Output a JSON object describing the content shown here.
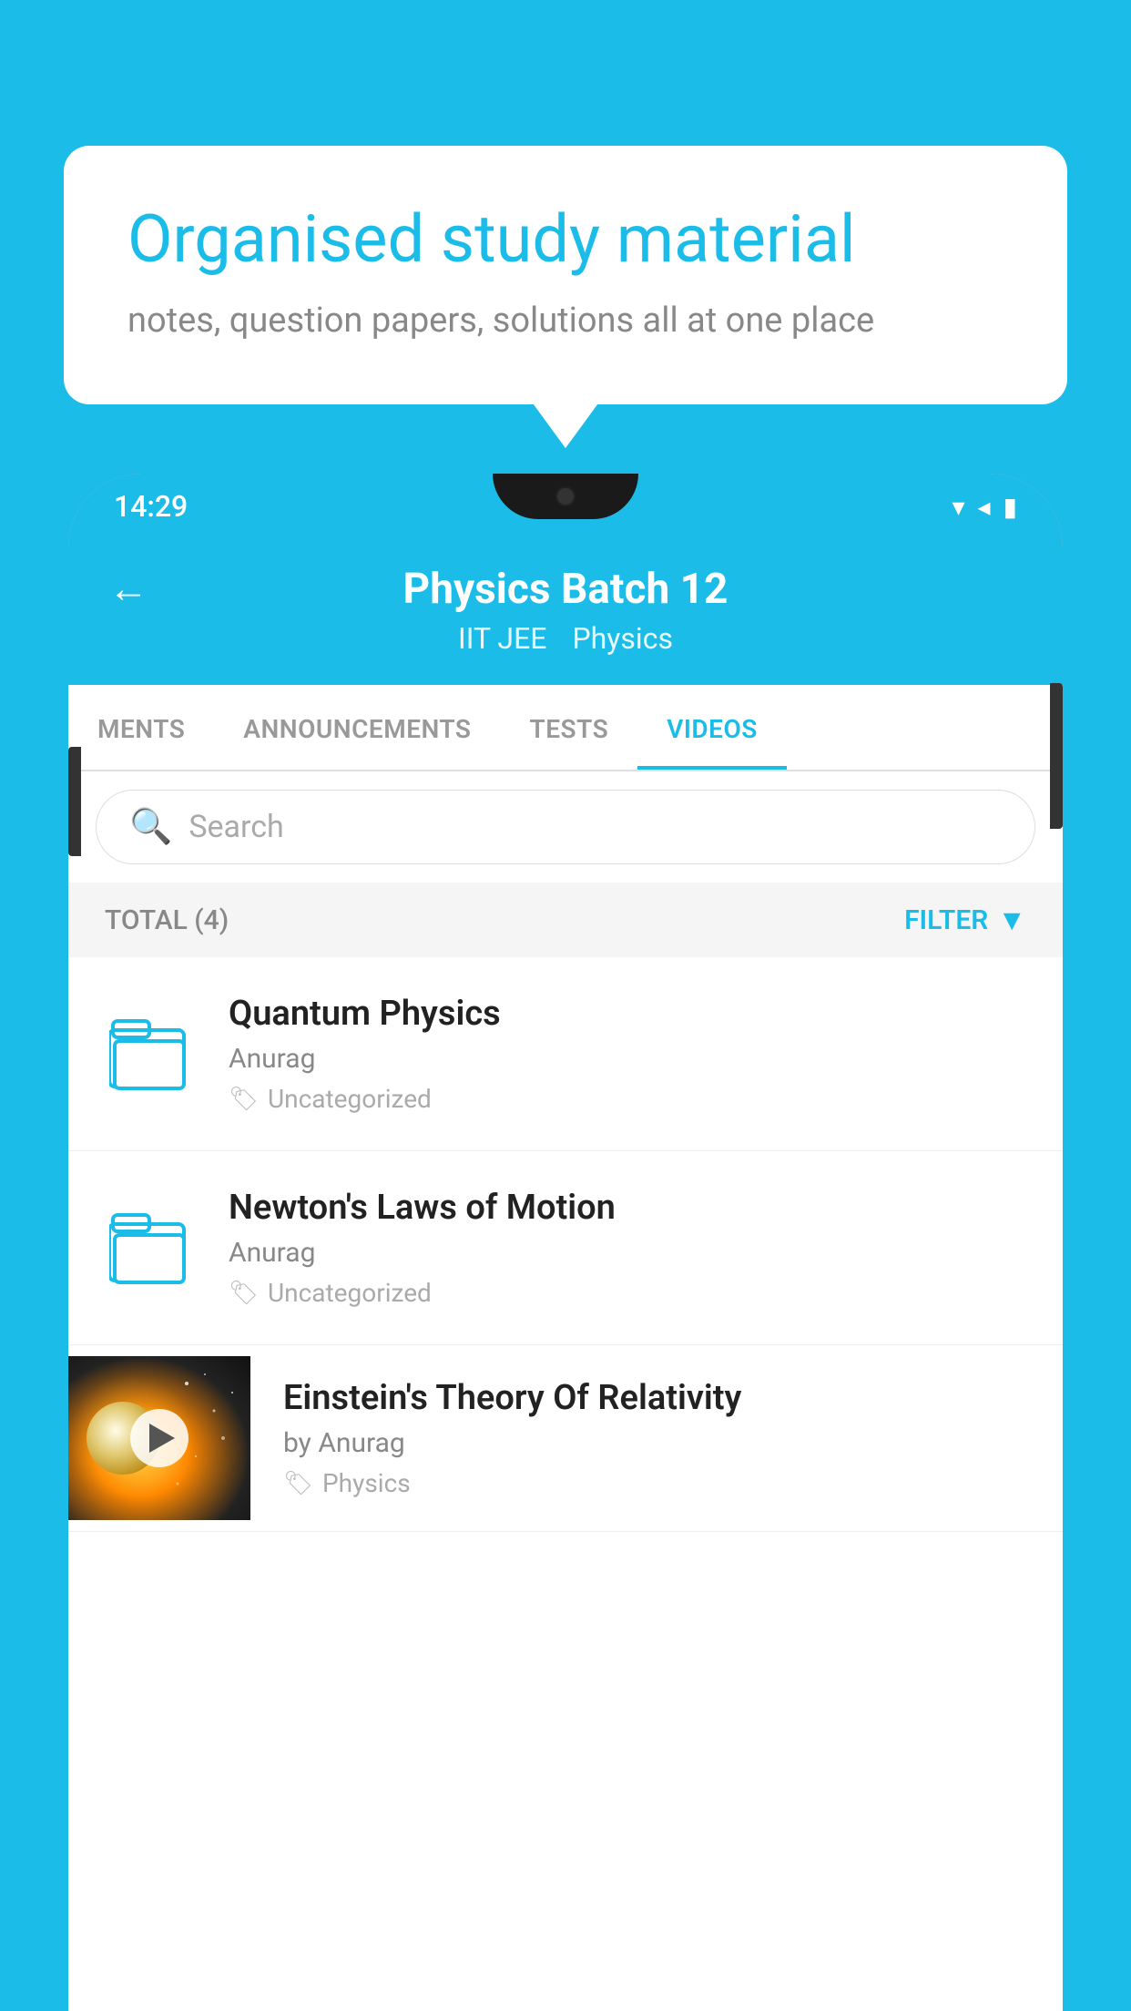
{
  "background": {
    "color": "#1bbde8"
  },
  "speech_bubble": {
    "title": "Organised study material",
    "subtitle": "notes, question papers, solutions all at one place"
  },
  "status_bar": {
    "time": "14:29",
    "wifi": "▾",
    "signal": "▴",
    "battery": "▮"
  },
  "app_header": {
    "title": "Physics Batch 12",
    "tag1": "IIT JEE",
    "tag2": "Physics",
    "back_label": "←"
  },
  "tabs": [
    {
      "label": "MENTS",
      "active": false
    },
    {
      "label": "ANNOUNCEMENTS",
      "active": false
    },
    {
      "label": "TESTS",
      "active": false
    },
    {
      "label": "VIDEOS",
      "active": true
    }
  ],
  "search": {
    "placeholder": "Search"
  },
  "filter_bar": {
    "total_label": "TOTAL (4)",
    "filter_label": "FILTER"
  },
  "video_items": [
    {
      "title": "Quantum Physics",
      "author": "Anurag",
      "tag": "Uncategorized",
      "type": "folder"
    },
    {
      "title": "Newton's Laws of Motion",
      "author": "Anurag",
      "tag": "Uncategorized",
      "type": "folder"
    },
    {
      "title": "Einstein's Theory Of Relativity",
      "author": "by Anurag",
      "tag": "Physics",
      "type": "video"
    }
  ]
}
